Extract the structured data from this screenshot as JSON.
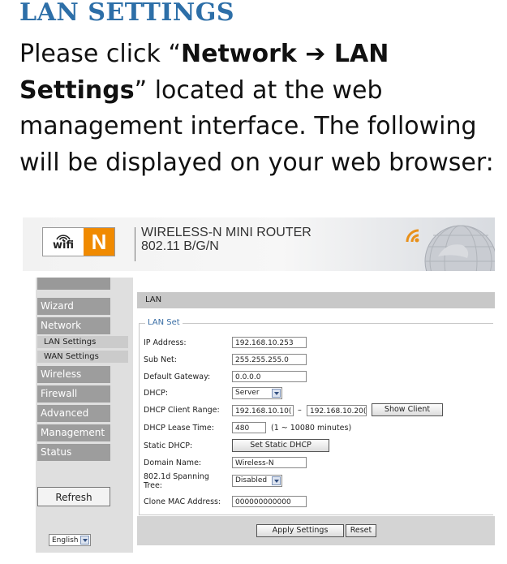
{
  "doc": {
    "title": "LAN SETTINGS",
    "para_pre": "Please click “",
    "para_bold": "Network ➔ LAN Settings",
    "para_post": "” located at the web management interface. The following will be displayed on your web browser:"
  },
  "header": {
    "logo_wifi": "wifi",
    "logo_n": "N",
    "product_name": "WIRELESS-N MINI ROUTER",
    "product_standard": "802.11 B/G/N"
  },
  "nav": {
    "items": [
      "Wizard",
      "Network",
      "Wireless",
      "Firewall",
      "Advanced",
      "Management",
      "Status"
    ],
    "sub_items": [
      "LAN Settings",
      "WAN Settings"
    ],
    "refresh": "Refresh",
    "language": "English"
  },
  "panel": {
    "title": "LAN",
    "legend": "LAN Set",
    "labels": {
      "ip": "IP Address:",
      "subnet": "Sub Net:",
      "gateway": "Default Gateway:",
      "dhcp": "DHCP:",
      "range": "DHCP Client Range:",
      "lease": "DHCP Lease Time:",
      "static": "Static DHCP:",
      "domain": "Domain Name:",
      "stp_1": "802.1d Spanning",
      "stp_2": "Tree:",
      "mac": "Clone MAC Address:"
    },
    "values": {
      "ip": "192.168.10.253",
      "subnet": "255.255.255.0",
      "gateway": "0.0.0.0",
      "dhcp": "Server",
      "range_start": "192.168.10.10(",
      "range_sep": "–",
      "range_end": "192.168.10.20(",
      "lease": "480",
      "lease_hint": "(1 ~ 10080 minutes)",
      "domain": "Wireless-N",
      "stp": "Disabled",
      "mac": "000000000000"
    },
    "buttons": {
      "show_client": "Show Client",
      "set_static": "Set Static DHCP",
      "apply": "Apply Settings",
      "reset": "Reset"
    }
  }
}
